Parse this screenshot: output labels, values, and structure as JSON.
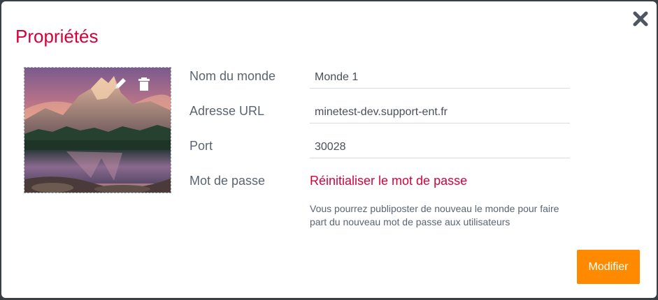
{
  "dialog": {
    "title": "Propriétés",
    "close_icon": "close-icon"
  },
  "image": {
    "edit_icon": "pencil-icon",
    "delete_icon": "trash-icon"
  },
  "form": {
    "name_label": "Nom du monde",
    "name_value": "Monde 1",
    "url_label": "Adresse URL",
    "url_value": "minetest-dev.support-ent.fr",
    "port_label": "Port",
    "port_value": "30028",
    "password_label": "Mot de passe",
    "reset_password_link": "Réinitialiser le mot de passe",
    "hint": "Vous pourrez publiposter de nouveau le monde pour faire part du nouveau mot de passe aux utilisateurs"
  },
  "actions": {
    "submit_label": "Modifier"
  },
  "colors": {
    "accent": "#d6003a",
    "button": "#ff8a00",
    "text": "#5b6472"
  }
}
